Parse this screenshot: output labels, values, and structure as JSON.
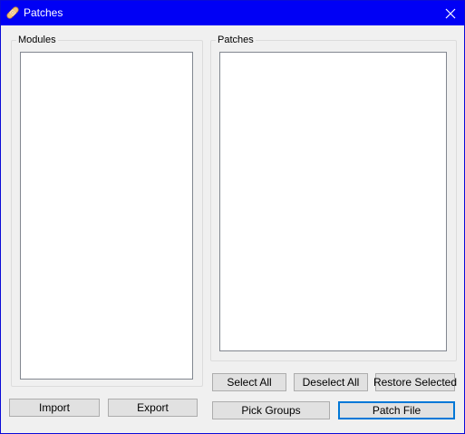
{
  "window": {
    "title": "Patches",
    "title_bar_color": "#0000f5",
    "icon": "bandage-icon"
  },
  "modules_group": {
    "label": "Modules",
    "items": []
  },
  "patches_group": {
    "label": "Patches",
    "items": []
  },
  "buttons": {
    "import": "Import",
    "export": "Export",
    "select_all": "Select All",
    "deselect_all": "Deselect All",
    "restore_selected": "Restore Selected",
    "pick_groups": "Pick Groups",
    "patch_file": "Patch File"
  },
  "default_button": "patch_file",
  "accent_color": "#0078d7"
}
